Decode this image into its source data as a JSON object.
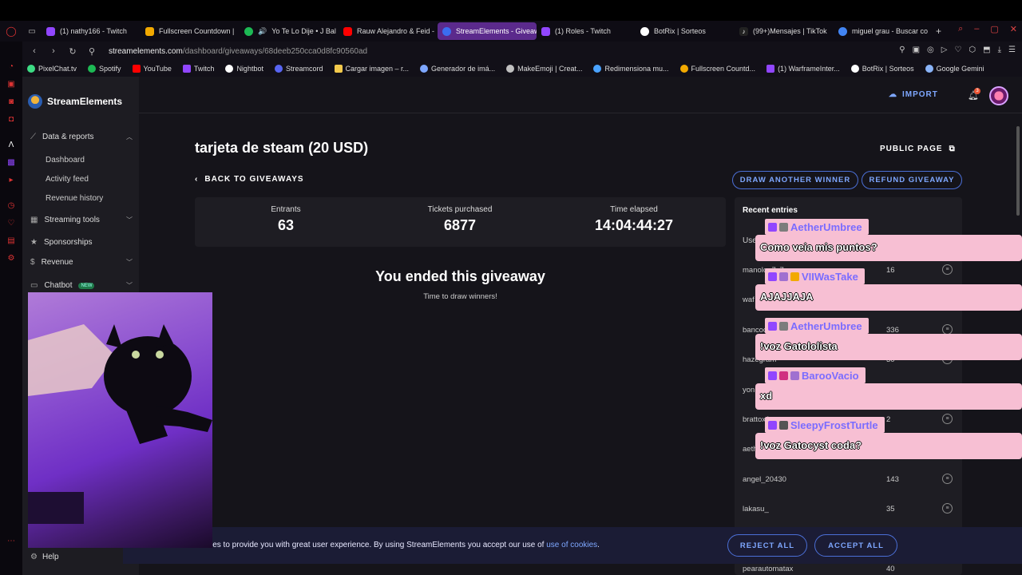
{
  "browser": {
    "tabs": [
      {
        "label": "(1) nathy166 - Twitch",
        "icon_color": "#9146ff"
      },
      {
        "label": "Fullscreen Countdown |",
        "icon_color": "#f2a900"
      },
      {
        "label": "Yo Te Lo Dije • J Bal",
        "icon_color": "#1db954"
      },
      {
        "label": "Rauw Alejandro & Feid -",
        "icon_color": "#ff0000"
      },
      {
        "label": "StreamElements - Giveaw",
        "icon_color": "#3b6df0"
      },
      {
        "label": "(1) Roles - Twitch",
        "icon_color": "#9146ff"
      },
      {
        "label": "BotRix | Sorteos",
        "icon_color": "#ffffff"
      },
      {
        "label": "(99+)Mensajes | TikTok",
        "icon_color": "#222222"
      },
      {
        "label": "miguel grau - Buscar co",
        "icon_color": "#4285f4"
      }
    ],
    "new_tab": "+",
    "url_host": "streamelements.com",
    "url_path": "/dashboard/giveaways/68deeb250cca0d8fc90560ad",
    "bookmarks": [
      {
        "label": "PixelChat.tv",
        "color": "#3ddc84"
      },
      {
        "label": "Spotify",
        "color": "#1db954"
      },
      {
        "label": "YouTube",
        "color": "#ff0000"
      },
      {
        "label": "Twitch",
        "color": "#9146ff"
      },
      {
        "label": "Nightbot",
        "color": "#ffffff"
      },
      {
        "label": "Streamcord",
        "color": "#5865f2"
      },
      {
        "label": "Cargar imagen – r...",
        "color": "#f2c94c"
      },
      {
        "label": "Generador de imá...",
        "color": "#7ea7ff"
      },
      {
        "label": "MakeEmoji | Creat...",
        "color": "#c0c0c0"
      },
      {
        "label": "Redimensiona mu...",
        "color": "#4aa3ff"
      },
      {
        "label": "Fullscreen Countd...",
        "color": "#f2a900"
      },
      {
        "label": "(1) WarframeInter...",
        "color": "#9146ff"
      },
      {
        "label": "BotRix | Sorteos",
        "color": "#ffffff"
      },
      {
        "label": "Google Gemini",
        "color": "#8ab4f8"
      }
    ]
  },
  "sidebar": {
    "brand": "StreamElements",
    "sections": {
      "data_reports": "Data & reports",
      "dashboard": "Dashboard",
      "activity_feed": "Activity feed",
      "revenue_history": "Revenue history",
      "streaming_tools": "Streaming tools",
      "sponsorships": "Sponsorships",
      "revenue": "Revenue",
      "chatbot": "Chatbot",
      "chatbot_badge": "NEW",
      "help": "Help"
    }
  },
  "header": {
    "import": "IMPORT",
    "notif_count": "3"
  },
  "giveaway": {
    "title": "tarjeta de steam (20 USD)",
    "public_page": "PUBLIC PAGE",
    "back": "BACK TO GIVEAWAYS",
    "draw_another": "DRAW ANOTHER WINNER",
    "refund": "REFUND GIVEAWAY",
    "stats": {
      "entrants_label": "Entrants",
      "entrants": "63",
      "tickets_label": "Tickets purchased",
      "tickets": "6877",
      "elapsed_label": "Time elapsed",
      "elapsed": "14:04:44:27"
    },
    "ended_title": "You ended this giveaway",
    "ended_sub": "Time to draw winners!"
  },
  "recent": {
    "title": "Recent entries",
    "header_user": "Use",
    "entries": [
      {
        "name": "manolo_7x7",
        "num": "16"
      },
      {
        "name": "waf",
        "num": ""
      },
      {
        "name": "bancoc",
        "num": "336"
      },
      {
        "name": "hazegram",
        "num": "30"
      },
      {
        "name": "yon",
        "num": ""
      },
      {
        "name": "brattox1",
        "num": "2"
      },
      {
        "name": "aeth",
        "num": ""
      },
      {
        "name": "angel_20430",
        "num": "143"
      },
      {
        "name": "lakasu_",
        "num": "35"
      },
      {
        "name": "",
        "num": ""
      },
      {
        "name": "pearautomatax",
        "num": "40"
      }
    ]
  },
  "cookie": {
    "text": "ies to provide you with great user experience. By using StreamElements you accept our use of",
    "link": "use of cookies",
    "end": ".",
    "reject": "REJECT ALL",
    "accept": "ACCEPT ALL"
  },
  "chat_overlay": [
    {
      "user": "AetherUmbree",
      "message": "Como veia mis puntos?"
    },
    {
      "user": "VIIWasTake",
      "message": "AJAJJAJA"
    },
    {
      "user": "AetherUmbree",
      "message": "!voz Gatololista"
    },
    {
      "user": "BarooVacio",
      "message": "xd"
    },
    {
      "user": "SleepyFrostTurtle",
      "message": "!voz Gatocyst coda?"
    }
  ]
}
